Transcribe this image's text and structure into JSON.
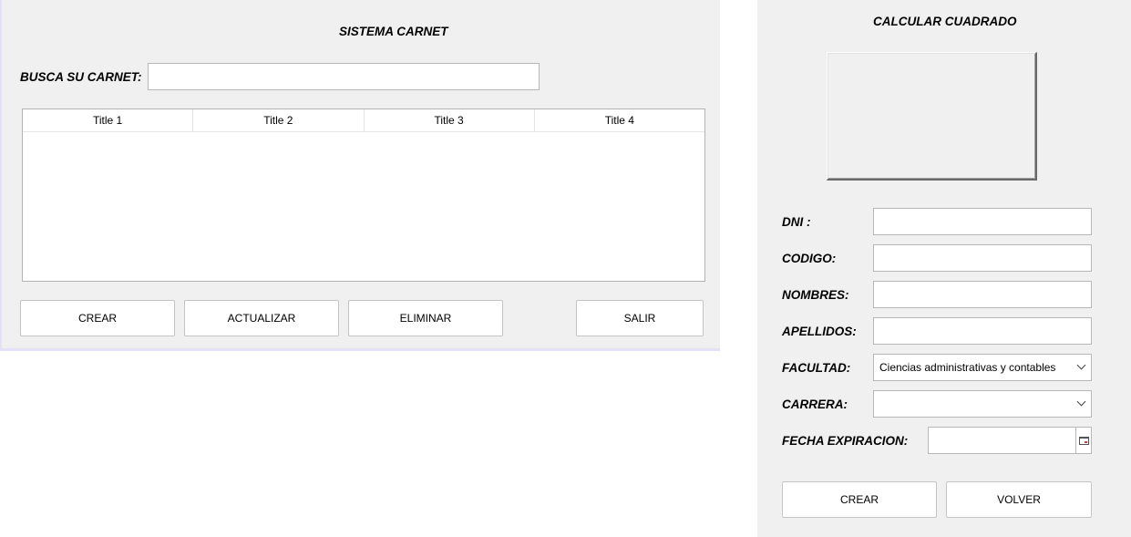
{
  "sistema": {
    "title": "SISTEMA CARNET",
    "search_label": "BUSCA SU CARNET:",
    "search_value": "",
    "table_columns": [
      "Title 1",
      "Title 2",
      "Title 3",
      "Title 4"
    ],
    "buttons": {
      "crear": "CREAR",
      "actualizar": "ACTUALIZAR",
      "eliminar": "ELIMINAR",
      "salir": "SALIR"
    }
  },
  "form": {
    "title": "CALCULAR CUADRADO",
    "dni_label": "DNI :",
    "codigo_label": "CODIGO:",
    "nombres_label": "NOMBRES:",
    "apellidos_label": "APELLIDOS:",
    "facultad_label": "FACULTAD:",
    "facultad_value": "Ciencias administrativas y contables",
    "carrera_label": "CARRERA:",
    "carrera_value": "",
    "fecha_label": "FECHA EXPIRACION:",
    "buttons": {
      "crear": "CREAR",
      "volver": "VOLVER"
    }
  },
  "icons": {
    "calendar": "calendar-icon",
    "dropdown": "chevron-down-icon"
  }
}
